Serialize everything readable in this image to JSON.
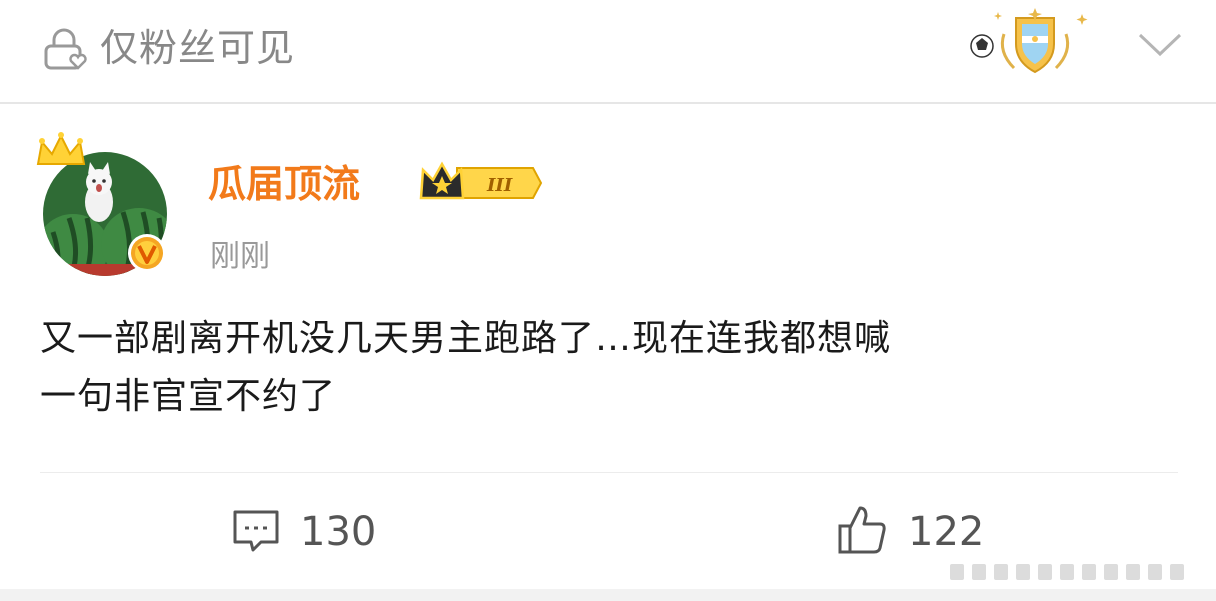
{
  "header": {
    "visibility_label": "仅粉丝可见",
    "lock_icon": "lock-heart-icon",
    "badge_icon": "argentina-football-badge-icon",
    "chevron_icon": "chevron-down-icon"
  },
  "post": {
    "username": "瓜届顶流",
    "vip_level": "III",
    "timestamp": "刚刚",
    "text": "又一部剧离开机没几天男主跑路了…现在连我都想喊\n一句非官宣不约了",
    "avatar": "watermelon-cat-avatar",
    "verified_icon": "verified-v-icon"
  },
  "actions": {
    "comment_count": "130",
    "like_count": "122",
    "comment_icon": "comment-icon",
    "like_icon": "thumbs-up-icon"
  },
  "colors": {
    "username": "#f27a1a",
    "muted": "#888888",
    "accent_gold": "#f5b400",
    "verified_orange": "#f08a00"
  }
}
